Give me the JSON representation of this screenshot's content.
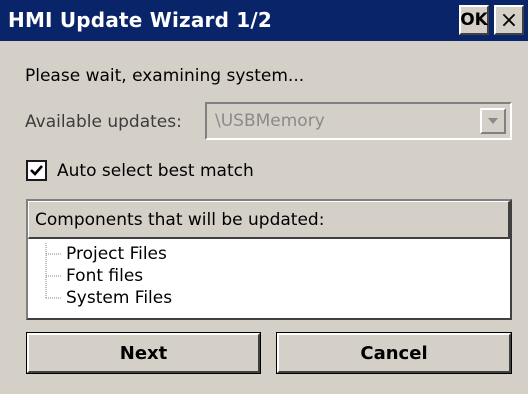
{
  "window": {
    "title": "HMI Update Wizard 1/2",
    "ok_label": "OK",
    "close_label": "×"
  },
  "status": {
    "text": "Please wait, examining system..."
  },
  "available_updates": {
    "label": "Available updates:",
    "value": "\\USBMemory",
    "enabled": false
  },
  "auto_select": {
    "label": "Auto select best match",
    "checked": true
  },
  "components": {
    "header": "Components that will be updated:",
    "items": [
      {
        "label": "Project Files"
      },
      {
        "label": "Font files"
      },
      {
        "label": "System Files"
      }
    ]
  },
  "buttons": {
    "next_label": "Next",
    "cancel_label": "Cancel"
  },
  "colors": {
    "titlebar": "#0a246a",
    "face": "#d4d0c8",
    "disabled_text": "#8a8a8a"
  }
}
